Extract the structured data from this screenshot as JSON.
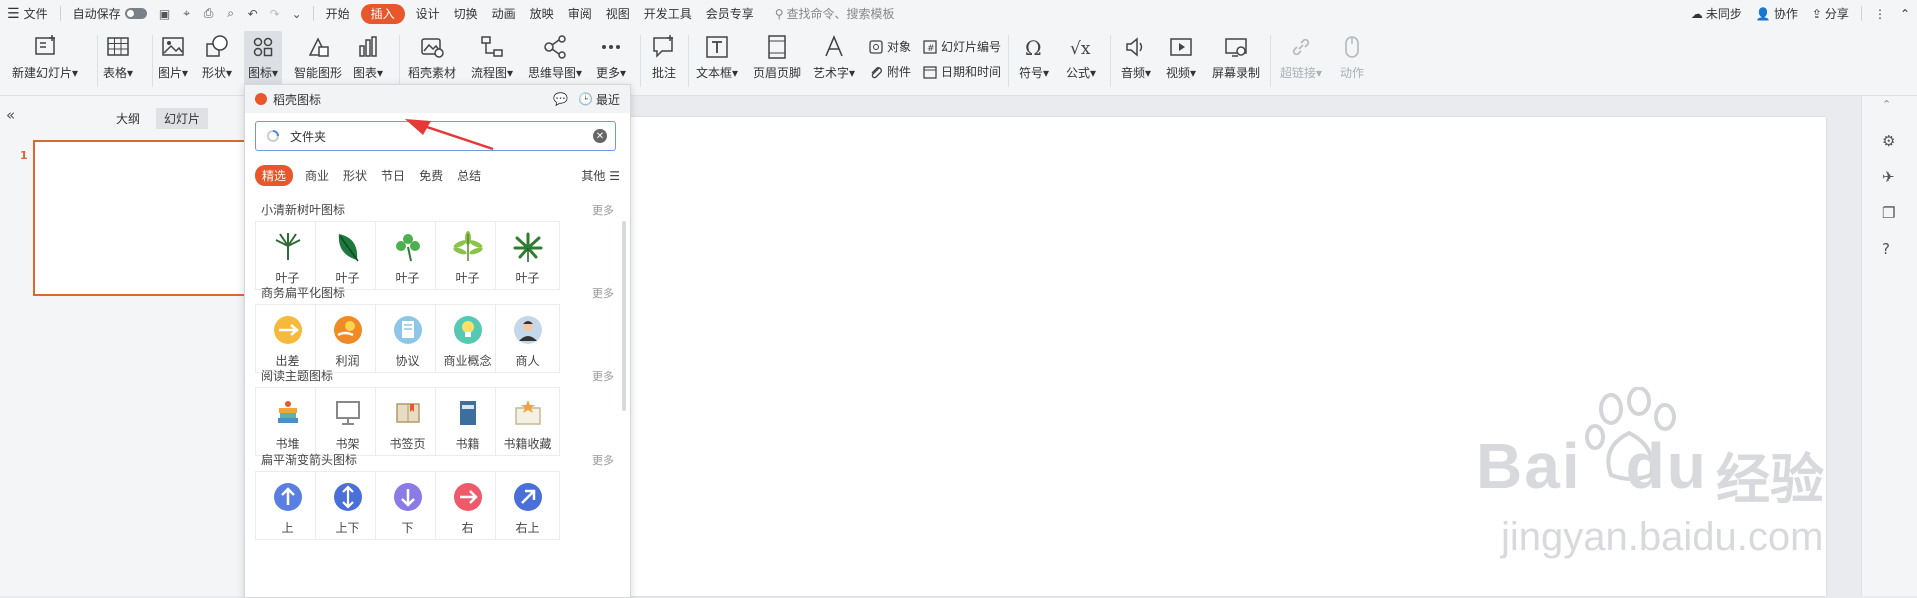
{
  "menubar": {
    "file": "文件",
    "autosave": "自动保存",
    "tabs": [
      "开始",
      "插入",
      "设计",
      "切换",
      "动画",
      "放映",
      "审阅",
      "视图",
      "开发工具",
      "会员专享"
    ],
    "active_tab_index": 1,
    "search_placeholder": "查找命令、搜索模板",
    "right": {
      "sync": "未同步",
      "collab": "协作",
      "share": "分享"
    }
  },
  "ribbon": {
    "new_slide": "新建幻灯片",
    "table": "表格",
    "picture": "图片",
    "shape": "形状",
    "icon": "图标",
    "smartart": "智能图形",
    "chart": "图表",
    "material": "稻壳素材",
    "flowchart": "流程图",
    "mindmap": "思维导图",
    "more": "更多",
    "comment": "批注",
    "textbox": "文本框",
    "headerfooter": "页眉页脚",
    "wordart": "艺术字",
    "object": "对象",
    "attachment": "附件",
    "slidenum": "幻灯片编号",
    "datetime": "日期和时间",
    "symbol": "符号",
    "formula": "公式",
    "audio": "音频",
    "video": "视频",
    "screenrec": "屏幕录制",
    "hyperlink": "超链接",
    "action": "动作"
  },
  "leftpane": {
    "tab_outline": "大纲",
    "tab_slides": "幻灯片",
    "slide_number": "1"
  },
  "popup": {
    "title": "稻壳图标",
    "recent": "最近",
    "search_value": "文件夹",
    "categories": [
      "精选",
      "商业",
      "形状",
      "节日",
      "免费",
      "总结"
    ],
    "other": "其他",
    "sections": [
      {
        "title": "小清新树叶图标",
        "more": "更多",
        "items": [
          "叶子",
          "叶子",
          "叶子",
          "叶子",
          "叶子"
        ]
      },
      {
        "title": "商务扁平化图标",
        "more": "更多",
        "items": [
          "出差",
          "利润",
          "协议",
          "商业概念",
          "商人"
        ]
      },
      {
        "title": "阅读主题图标",
        "more": "更多",
        "items": [
          "书堆",
          "书架",
          "书签页",
          "书籍",
          "书籍收藏"
        ]
      },
      {
        "title": "扁平渐变箭头图标",
        "more": "更多",
        "items": [
          "上",
          "上下",
          "下",
          "右",
          "右上"
        ]
      }
    ]
  },
  "watermark": {
    "brand": "Bai",
    "brand2": "du",
    "cn": "经验",
    "url": "jingyan.baidu.com"
  },
  "colors": {
    "accent": "#e8562c",
    "arrow": "#e53935",
    "slide_border": "#d9692e"
  }
}
